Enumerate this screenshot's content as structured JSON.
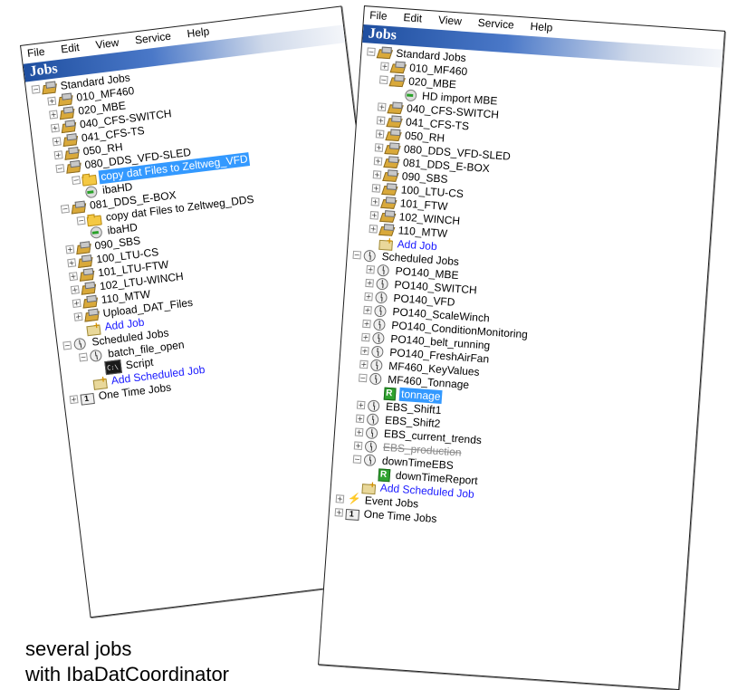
{
  "menu": [
    "File",
    "Edit",
    "View",
    "Service",
    "Help"
  ],
  "header": "Jobs",
  "left_tree": [
    {
      "level": 0,
      "exp": "-",
      "icon": "jobs",
      "label": "Standard Jobs"
    },
    {
      "level": 1,
      "exp": "+",
      "icon": "jobs",
      "label": "010_MF460"
    },
    {
      "level": 1,
      "exp": "+",
      "icon": "jobs",
      "label": "020_MBE"
    },
    {
      "level": 1,
      "exp": "+",
      "icon": "jobs",
      "label": "040_CFS-SWITCH"
    },
    {
      "level": 1,
      "exp": "+",
      "icon": "jobs",
      "label": "041_CFS-TS"
    },
    {
      "level": 1,
      "exp": "+",
      "icon": "jobs",
      "label": "050_RH"
    },
    {
      "level": 1,
      "exp": "-",
      "icon": "jobs",
      "label": "080_DDS_VFD-SLED"
    },
    {
      "level": 2,
      "exp": "-",
      "icon": "folder",
      "label": "copy dat Files to Zeltweg_VFD",
      "selected": true
    },
    {
      "level": 2,
      "exp": "",
      "icon": "import",
      "label": "ibaHD"
    },
    {
      "level": 1,
      "exp": "-",
      "icon": "jobs",
      "label": "081_DDS_E-BOX"
    },
    {
      "level": 2,
      "exp": "-",
      "icon": "folder",
      "label": "copy dat Files to Zeltweg_DDS"
    },
    {
      "level": 2,
      "exp": "",
      "icon": "import",
      "label": "ibaHD"
    },
    {
      "level": 1,
      "exp": "+",
      "icon": "jobs",
      "label": "090_SBS"
    },
    {
      "level": 1,
      "exp": "+",
      "icon": "jobs",
      "label": "100_LTU-CS"
    },
    {
      "level": 1,
      "exp": "+",
      "icon": "jobs",
      "label": "101_LTU-FTW"
    },
    {
      "level": 1,
      "exp": "+",
      "icon": "jobs",
      "label": "102_LTU-WINCH"
    },
    {
      "level": 1,
      "exp": "+",
      "icon": "jobs",
      "label": "110_MTW"
    },
    {
      "level": 1,
      "exp": "+",
      "icon": "jobs",
      "label": "Upload_DAT_Files"
    },
    {
      "level": 1,
      "exp": "",
      "icon": "add",
      "label": "Add Job",
      "link": true
    },
    {
      "level": 0,
      "exp": "-",
      "icon": "clock",
      "label": "Scheduled Jobs"
    },
    {
      "level": 1,
      "exp": "-",
      "icon": "clock",
      "label": "batch_file_open"
    },
    {
      "level": 2,
      "exp": "",
      "icon": "script",
      "label": "Script"
    },
    {
      "level": 1,
      "exp": "",
      "icon": "add",
      "label": "Add Scheduled Job",
      "link": true
    },
    {
      "level": 0,
      "exp": "+",
      "icon": "onetime",
      "label": "One Time Jobs"
    }
  ],
  "right_tree": [
    {
      "level": 0,
      "exp": "-",
      "icon": "jobs",
      "label": "Standard Jobs"
    },
    {
      "level": 1,
      "exp": "+",
      "icon": "jobs",
      "label": "010_MF460"
    },
    {
      "level": 1,
      "exp": "-",
      "icon": "jobs",
      "label": "020_MBE"
    },
    {
      "level": 2,
      "exp": "",
      "icon": "import",
      "label": "HD import MBE"
    },
    {
      "level": 1,
      "exp": "+",
      "icon": "jobs",
      "label": "040_CFS-SWITCH"
    },
    {
      "level": 1,
      "exp": "+",
      "icon": "jobs",
      "label": "041_CFS-TS"
    },
    {
      "level": 1,
      "exp": "+",
      "icon": "jobs",
      "label": "050_RH"
    },
    {
      "level": 1,
      "exp": "+",
      "icon": "jobs",
      "label": "080_DDS_VFD-SLED"
    },
    {
      "level": 1,
      "exp": "+",
      "icon": "jobs",
      "label": "081_DDS_E-BOX"
    },
    {
      "level": 1,
      "exp": "+",
      "icon": "jobs",
      "label": "090_SBS"
    },
    {
      "level": 1,
      "exp": "+",
      "icon": "jobs",
      "label": "100_LTU-CS"
    },
    {
      "level": 1,
      "exp": "+",
      "icon": "jobs",
      "label": "101_FTW"
    },
    {
      "level": 1,
      "exp": "+",
      "icon": "jobs",
      "label": "102_WINCH"
    },
    {
      "level": 1,
      "exp": "+",
      "icon": "jobs",
      "label": "110_MTW"
    },
    {
      "level": 1,
      "exp": "",
      "icon": "add",
      "label": "Add Job",
      "link": true
    },
    {
      "level": 0,
      "exp": "-",
      "icon": "clock",
      "label": "Scheduled Jobs"
    },
    {
      "level": 1,
      "exp": "+",
      "icon": "clock",
      "label": "PO140_MBE"
    },
    {
      "level": 1,
      "exp": "+",
      "icon": "clock",
      "label": "PO140_SWITCH"
    },
    {
      "level": 1,
      "exp": "+",
      "icon": "clock",
      "label": "PO140_VFD"
    },
    {
      "level": 1,
      "exp": "+",
      "icon": "clock",
      "label": "PO140_ScaleWinch"
    },
    {
      "level": 1,
      "exp": "+",
      "icon": "clock",
      "label": "PO140_ConditionMonitoring"
    },
    {
      "level": 1,
      "exp": "+",
      "icon": "clock",
      "label": "PO140_belt_running"
    },
    {
      "level": 1,
      "exp": "+",
      "icon": "clock",
      "label": "PO140_FreshAirFan"
    },
    {
      "level": 1,
      "exp": "+",
      "icon": "clock",
      "label": "MF460_KeyValues"
    },
    {
      "level": 1,
      "exp": "-",
      "icon": "clock",
      "label": "MF460_Tonnage"
    },
    {
      "level": 2,
      "exp": "",
      "icon": "green",
      "label": "tonnage",
      "selected": true
    },
    {
      "level": 1,
      "exp": "+",
      "icon": "clock",
      "label": "EBS_Shift1"
    },
    {
      "level": 1,
      "exp": "+",
      "icon": "clock",
      "label": "EBS_Shift2"
    },
    {
      "level": 1,
      "exp": "+",
      "icon": "clock",
      "label": "EBS_current_trends"
    },
    {
      "level": 1,
      "exp": "+",
      "icon": "clock",
      "label": "EBS_production",
      "disabled": true
    },
    {
      "level": 1,
      "exp": "-",
      "icon": "clock",
      "label": "downTimeEBS"
    },
    {
      "level": 2,
      "exp": "",
      "icon": "green",
      "label": "downTimeReport"
    },
    {
      "level": 1,
      "exp": "",
      "icon": "add",
      "label": "Add Scheduled Job",
      "link": true
    },
    {
      "level": 0,
      "exp": "+",
      "icon": "bolt",
      "label": "Event Jobs"
    },
    {
      "level": 0,
      "exp": "+",
      "icon": "onetime",
      "label": "One Time Jobs"
    }
  ],
  "caption": [
    "several jobs",
    "with IbaDatCoordinator"
  ]
}
